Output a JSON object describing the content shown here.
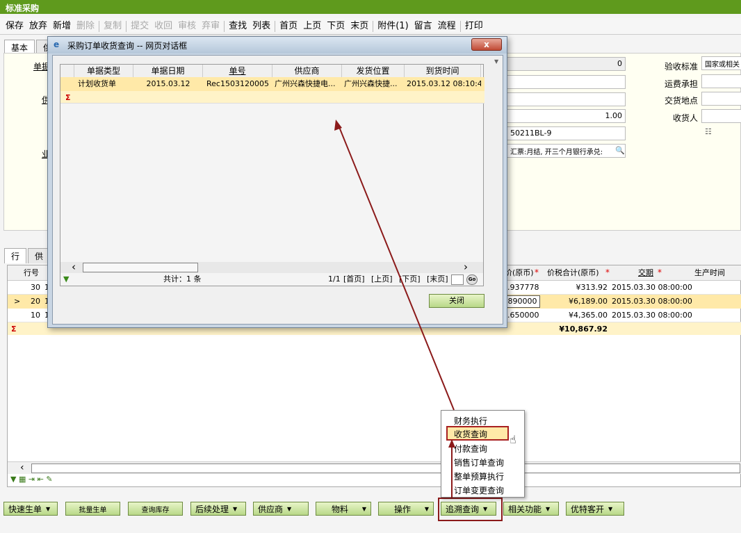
{
  "app": {
    "title": "标准采购"
  },
  "toolbar": {
    "items": [
      "保存",
      "放弃",
      "新增",
      "删除",
      "复制",
      "提交",
      "收回",
      "审核",
      "弃审",
      "查找",
      "列表",
      "首页",
      "上页",
      "下页",
      "末页",
      "附件(1)",
      "留言",
      "流程",
      "打印"
    ]
  },
  "form_tabs": [
    "基本",
    "供"
  ],
  "form": {
    "labels": {
      "doc": "单据",
      "supplier": "供",
      "business": "业"
    },
    "values": {
      "v1": "0",
      "v2": "",
      "v3": "",
      "v4": "1.00",
      "v5": "50211BL-9",
      "v6": "汇票:月结, 开三个月银行承兑:"
    },
    "right_labels": [
      "验收标准",
      "运费承担",
      "交货地点",
      "收货人"
    ],
    "right_values": [
      "国家或相关",
      "",
      "",
      ""
    ]
  },
  "grid_tabs": [
    "行",
    "供"
  ],
  "grid": {
    "headers": {
      "rowno": "行号",
      "price_orig": "价(原币)",
      "total_orig": "价税合计(原币)",
      "delivery": "交期",
      "prod_time": "生产时间"
    },
    "rows": [
      {
        "rowno": "30",
        "c1": "1",
        "price": ".937778",
        "total": "¥313.92",
        "delivery": "2015.03.30 08:00:00"
      },
      {
        "rowno": "20",
        "c1": "1",
        "price": ".890000",
        "total": "¥6,189.00",
        "delivery": "2015.03.30 08:00:00",
        "marker": ">"
      },
      {
        "rowno": "10",
        "c1": "1",
        "price": ".650000",
        "total": "¥4,365.00",
        "delivery": "2015.03.30 08:00:00"
      }
    ],
    "sum_symbol": "Σ",
    "sum_total": "¥10,867.92"
  },
  "bottom_buttons": [
    "快速生单",
    "批量生单",
    "查询库存",
    "后续处理",
    "供应商",
    "物料",
    "操作",
    "追溯查询",
    "相关功能",
    "优特客开"
  ],
  "menu": {
    "items": [
      "财务执行",
      "收货查询",
      "付款查询",
      "销售订单查询",
      "整单预算执行",
      "订单变更查询"
    ],
    "selected": "收货查询"
  },
  "dialog": {
    "title": "采购订单收货查询 -- 网页对话框",
    "close_glyph": "x",
    "headers": [
      "单据类型",
      "单据日期",
      "单号",
      "供应商",
      "发货位置",
      "到货时间"
    ],
    "rows": [
      {
        "type": "计划收货单",
        "date": "2015.03.12",
        "no": "Rec1503120005",
        "supplier": "广州兴森快捷电...",
        "ship_from": "广州兴森快捷...",
        "arrival": "2015.03.12 08:10:40"
      }
    ],
    "sum_symbol": "Σ",
    "total_text": "共计：1 条",
    "pager": {
      "page": "1/1",
      "first": "[首页]",
      "prev": "[上页]",
      "next": "[下页]",
      "last": "[末页]",
      "go": "Go"
    },
    "close_button": "关闭"
  },
  "colors": {
    "brand": "#5f9a1d",
    "highlight_row": "#ffe9a8",
    "callout": "#8b1a1a"
  }
}
